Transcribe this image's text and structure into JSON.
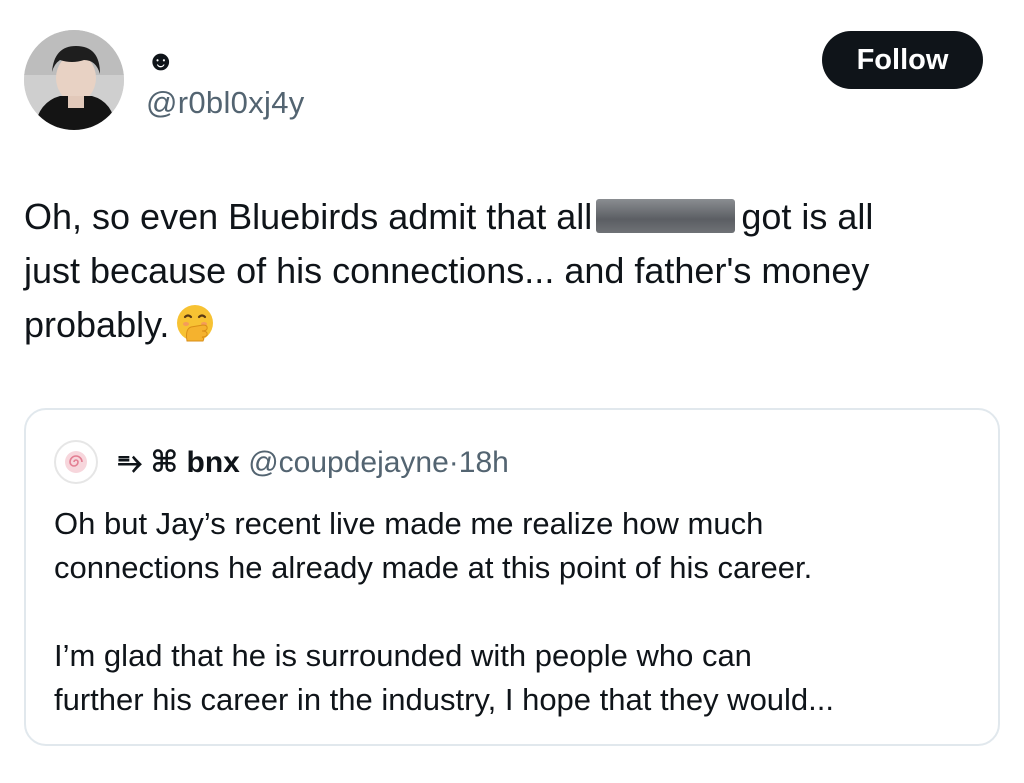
{
  "author": {
    "display_name": "☻",
    "handle": "@r0bl0xj4y",
    "avatar": "profile-photo"
  },
  "follow_label": "Follow",
  "tweet": {
    "line1_before": "Oh, so even Bluebirds admit that all",
    "line1_after": "got is all",
    "line2": "just because of his connections... and father's money",
    "line3": "probably.",
    "emoji": "face-with-hand-over-mouth-emoji"
  },
  "quote": {
    "display_name": "⥱ ⌘ bnx",
    "handle": "@coupdejayne",
    "separator": "·",
    "time": "18h",
    "avatar": "pink-swirl-avatar",
    "para1_line1": "Oh but Jay’s recent live made me realize how much",
    "para1_line2": "connections he already made at this point of his career.",
    "para2_line1": "I’m glad that he is surrounded with people who can",
    "para2_line2": "further his career in the industry, I hope that they would..."
  },
  "colors": {
    "text": "#0f1419",
    "secondary": "#536471",
    "button_bg": "#0f1419",
    "border": "#e1e8ed"
  }
}
